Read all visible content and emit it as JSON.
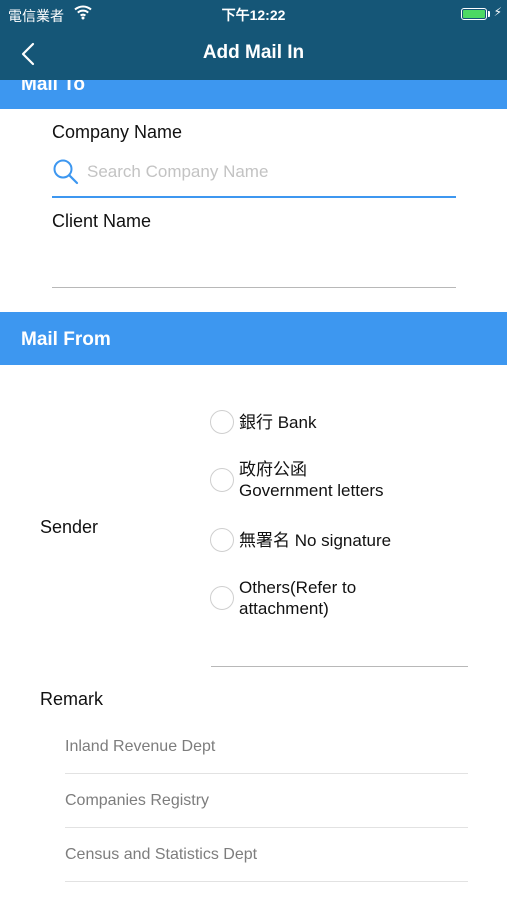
{
  "status_bar": {
    "carrier": "電信業者",
    "time": "下午12:22",
    "wifi_icon": "wifi-icon",
    "battery_icon": "battery-icon",
    "battery_level": 1.0,
    "charging_icon": "charging-bolt-icon"
  },
  "nav": {
    "title": "Add Mail In",
    "back_icon": "chevron-left-icon"
  },
  "mail_to": {
    "header": "Mail To",
    "company_label": "Company Name",
    "search_placeholder": "Search Company Name",
    "search_value": "",
    "search_icon": "search-icon",
    "client_label": "Client Name",
    "client_value": ""
  },
  "mail_from": {
    "header": "Mail From",
    "sender_label": "Sender",
    "sender_options": [
      {
        "label": "銀行 Bank",
        "selected": false
      },
      {
        "label": "政府公函\nGovernment letters",
        "selected": false
      },
      {
        "label": "無署名 No signature",
        "selected": false
      },
      {
        "label": "Others(Refer to\nattachment)",
        "selected": false
      }
    ],
    "remark_label": "Remark",
    "remarks": [
      "Inland Revenue Dept",
      "Companies Registry",
      "Census and Statistics Dept"
    ]
  },
  "colors": {
    "nav_background": "#155677",
    "section_header": "#3d97f0",
    "accent": "#3d97f0",
    "battery_fill": "#4cd964"
  }
}
